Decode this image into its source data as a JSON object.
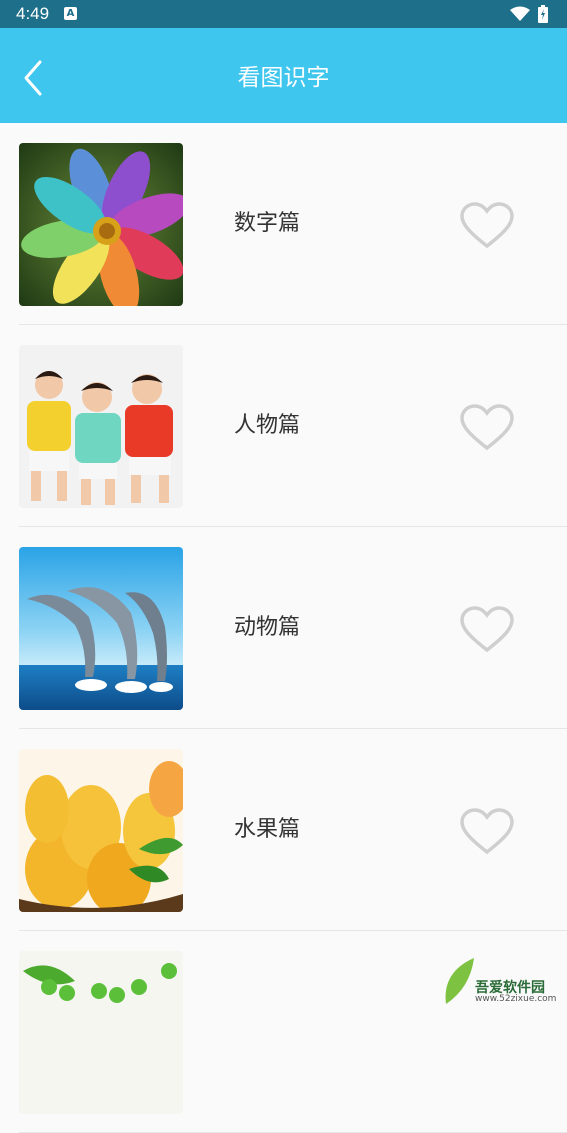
{
  "status_bar": {
    "time": "4:49",
    "notification_icon": "a-icon",
    "wifi_icon": "wifi-icon",
    "battery_icon": "battery-icon"
  },
  "app_bar": {
    "title": "看图识字",
    "back_icon": "chevron-left-icon",
    "background": "#3fc6ee"
  },
  "list": {
    "items": [
      {
        "label": "数字篇",
        "image": "colorful-flower",
        "favorite_icon": "heart-outline-icon"
      },
      {
        "label": "人物篇",
        "image": "three-boys",
        "favorite_icon": "heart-outline-icon"
      },
      {
        "label": "动物篇",
        "image": "dolphins",
        "favorite_icon": "heart-outline-icon"
      },
      {
        "label": "水果篇",
        "image": "mangoes",
        "favorite_icon": "heart-outline-icon"
      },
      {
        "label": "",
        "image": "peas",
        "favorite_icon": "heart-outline-icon"
      }
    ]
  },
  "watermark": {
    "text": "吾爱软件园",
    "url": "www.52zixue.com"
  },
  "colors": {
    "status_bar": "#1e6f8a",
    "heart": "#cccccc",
    "text": "#333333"
  }
}
